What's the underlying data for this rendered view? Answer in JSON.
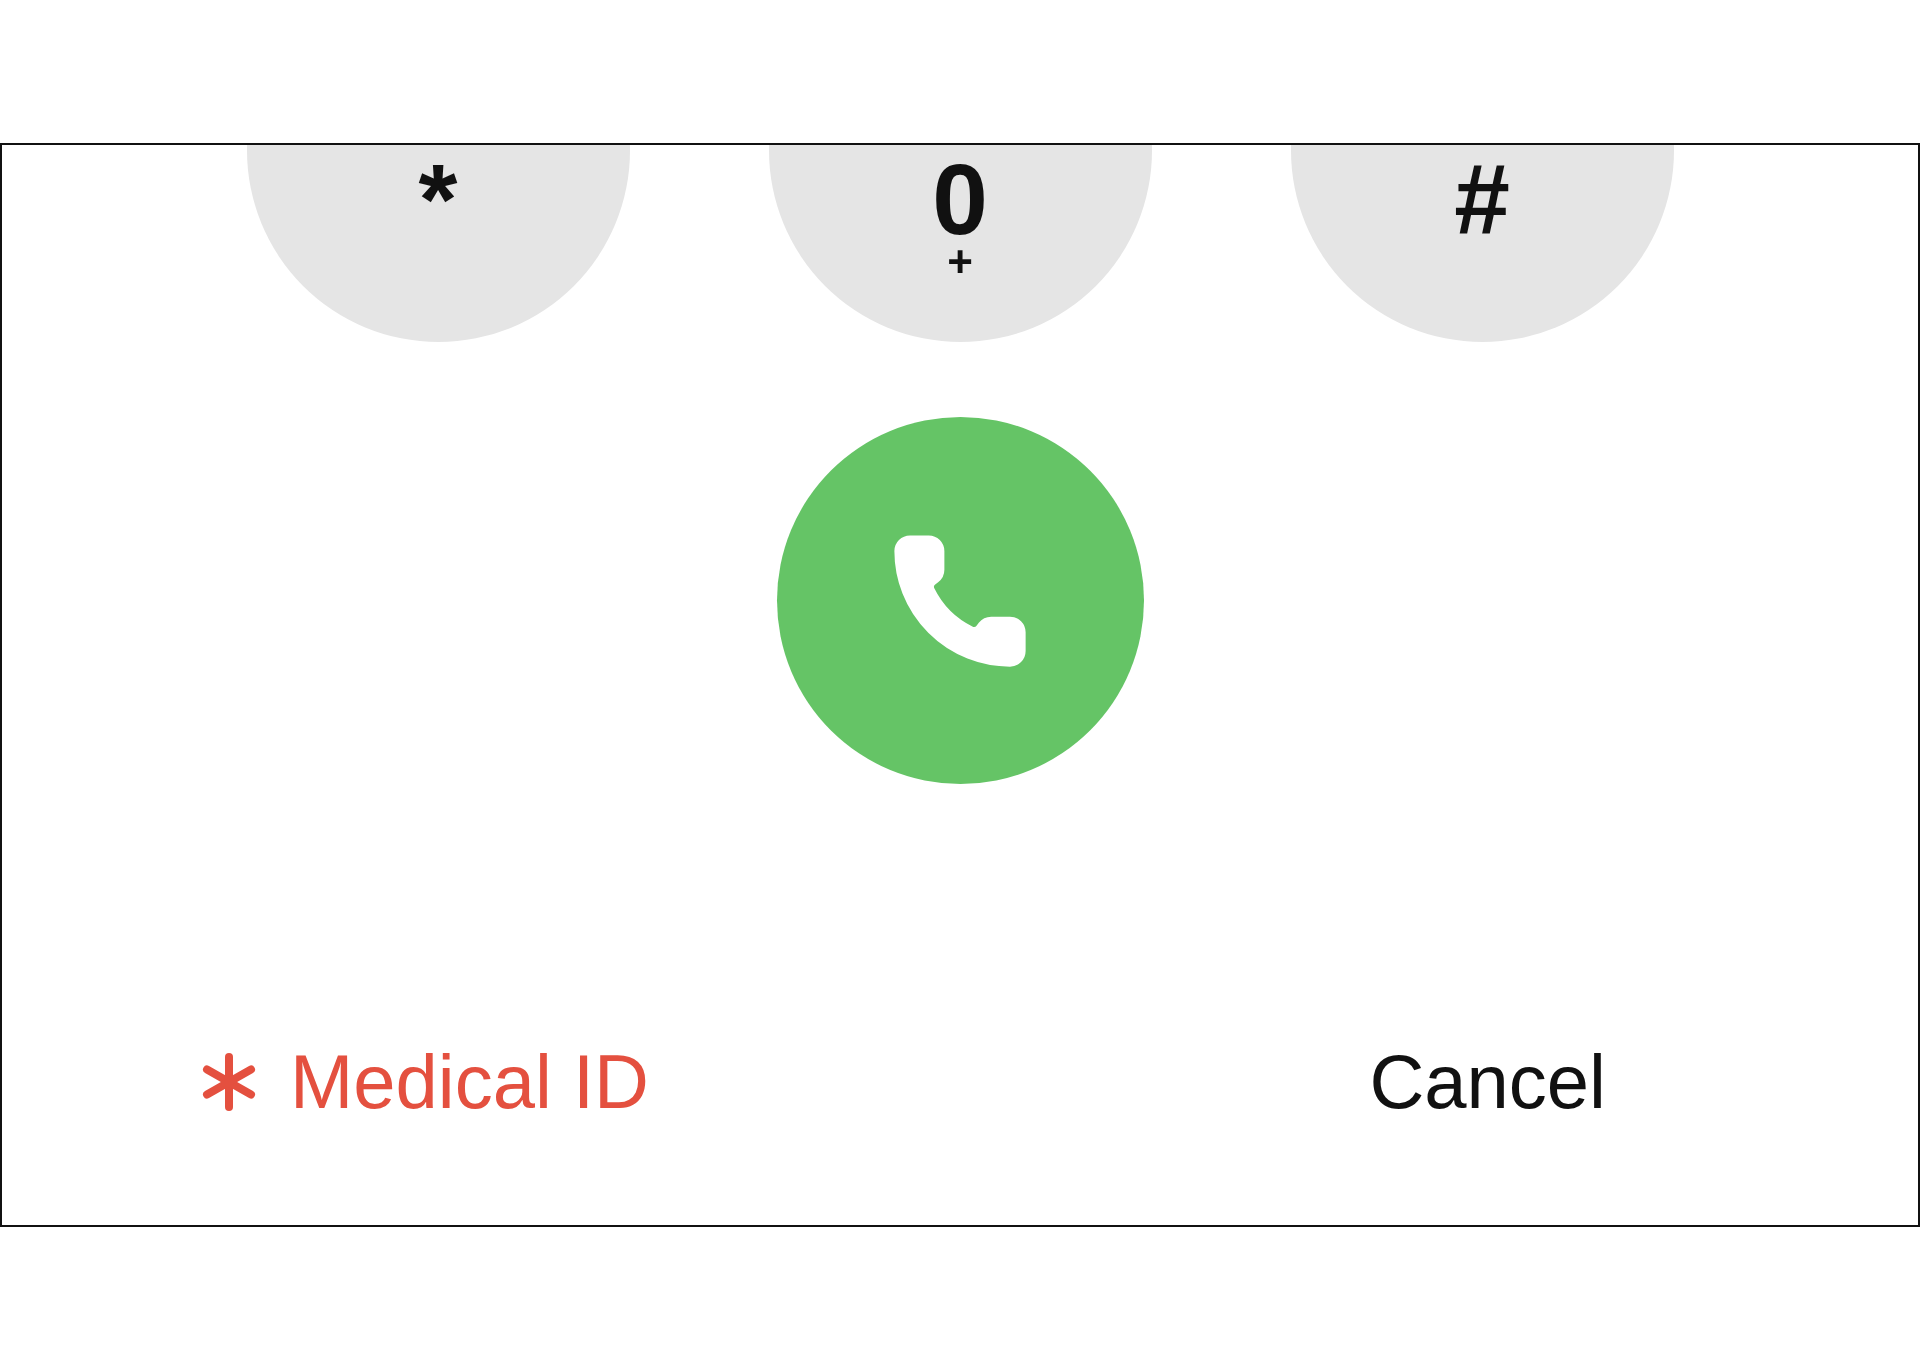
{
  "keypad": {
    "keys": [
      {
        "digit": "*"
      },
      {
        "digit": "0",
        "letters": "+"
      },
      {
        "digit": "#"
      }
    ]
  },
  "footer": {
    "medical_id": "Medical ID",
    "cancel": "Cancel"
  }
}
